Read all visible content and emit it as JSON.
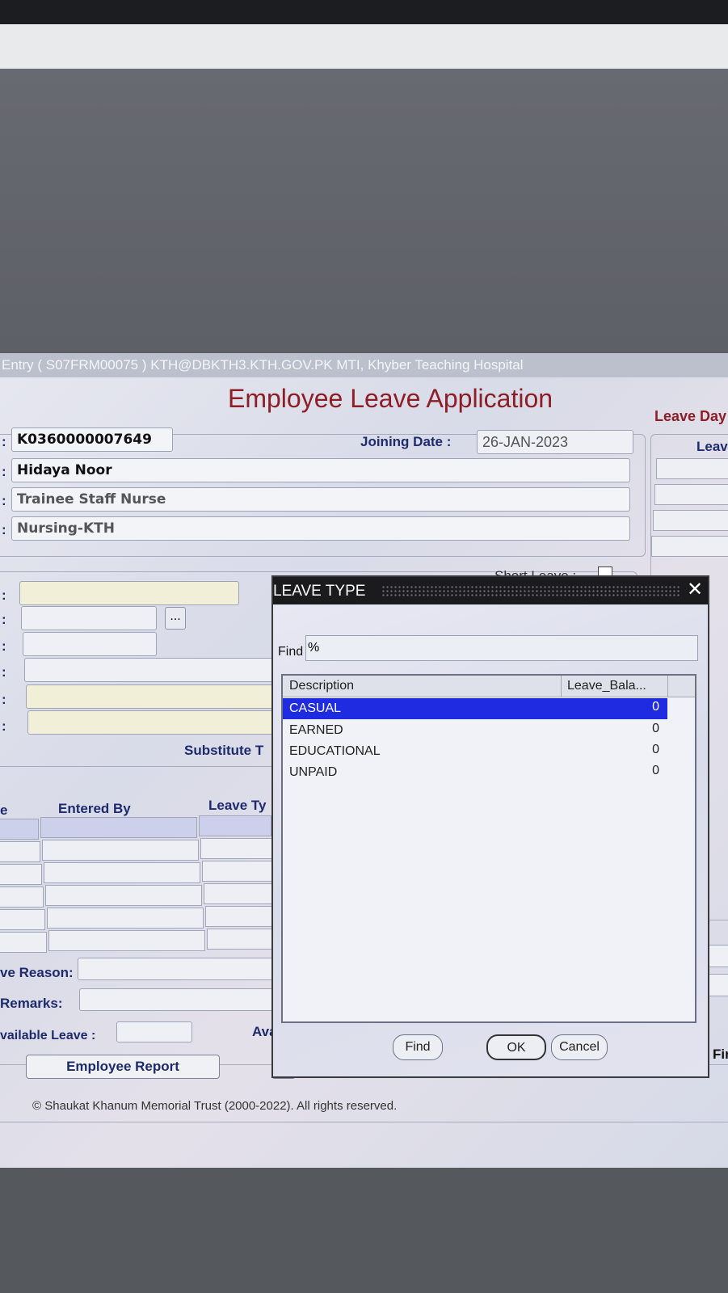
{
  "window": {
    "title": "Entry ( S07FRM00075 )  KTH@DBKTH3.KTH.GOV.PK   MTI, Khyber Teaching Hospital"
  },
  "form": {
    "title": "Employee Leave Application",
    "leave_days_label": "Leave Day",
    "leave_col_label": "Leav",
    "employee_code": "K0360000007649",
    "joining_date_label": "Joining Date :",
    "joining_date": "26-JAN-2023",
    "employee_name": "Hidaya Noor",
    "designation": "Trainee Staff Nurse",
    "department": "Nursing-KTH",
    "short_leave_label": "Short Leave :",
    "substitute_label": "Substitute T",
    "dots_button": "...",
    "grid_headers": {
      "col_e": "e",
      "entered_by": "Entered By",
      "leave_type": "Leave Ty"
    },
    "leave_reason_label": "ve Reason:",
    "remarks_label": "Remarks:",
    "available_leave_label": "vailable  Leave :",
    "ava_label": "Ava",
    "employee_report_button": "Employee Report",
    "fi_button": "Fir",
    "colon": ":",
    "footer": "© Shaukat Khanum Memorial Trust (2000-2022). All rights reserved."
  },
  "dialog": {
    "title": "LEAVE TYPE",
    "close": "✕",
    "find_label": "Find",
    "find_value": "%",
    "columns": {
      "description": "Description",
      "balance": "Leave_Bala..."
    },
    "rows": [
      {
        "description": "CASUAL",
        "balance": "0"
      },
      {
        "description": "EARNED",
        "balance": "0"
      },
      {
        "description": "EDUCATIONAL",
        "balance": "0"
      },
      {
        "description": "UNPAID",
        "balance": "0"
      }
    ],
    "selected_row": "CASUAL",
    "find_button": "Find",
    "ok_button": "OK",
    "cancel_button": "Cancel"
  }
}
